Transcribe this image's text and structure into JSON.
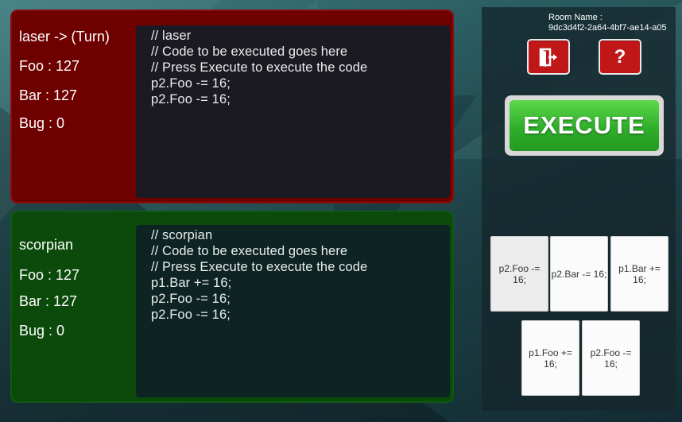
{
  "player1": {
    "name": "laser -> (Turn)",
    "stats": [
      "Foo : 127",
      "Bar : 127",
      "Bug : 0"
    ],
    "code": [
      "// laser",
      "// Code to be executed goes here",
      "// Press Execute to execute the code",
      "p2.Foo -= 16;",
      "p2.Foo -= 16;"
    ]
  },
  "player2": {
    "name": "scorpian",
    "stats": [
      "Foo : 127",
      "Bar : 127",
      "Bug : 0"
    ],
    "code": [
      "// scorpian",
      "// Code to be executed goes here",
      "// Press Execute to execute the code",
      "p1.Bar += 16;",
      "p2.Foo -= 16;",
      "p2.Foo -= 16;"
    ]
  },
  "room": {
    "label": "Room Name :",
    "id": "9dc3d4f2-2a64-4bf7-ae14-a05"
  },
  "controls": {
    "exit_icon": "exit-door-icon",
    "help_label": "?",
    "execute_label": "EXECUTE"
  },
  "cards": [
    "p2.Foo -= 16;",
    "p2.Bar -= 16;",
    "p1.Bar += 16;",
    "p1.Foo += 16;",
    "p2.Foo -= 16;"
  ],
  "colors": {
    "player1_panel": "#6f0000",
    "player2_panel": "#0b4a0b",
    "execute_green": "#3cc22e",
    "button_red": "#c01818"
  }
}
